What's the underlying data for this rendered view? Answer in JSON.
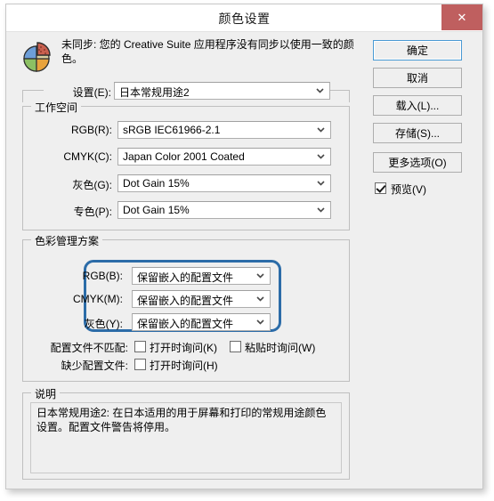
{
  "window": {
    "title": "颜色设置",
    "close_label": "✕"
  },
  "sync": {
    "icon": "color-wheel-icon",
    "message": "未同步: 您的 Creative Suite 应用程序没有同步以使用一致的颜色。"
  },
  "settings": {
    "label": "设置(E):",
    "value": "日本常规用途2"
  },
  "workspace": {
    "legend": "工作空间",
    "rows": [
      {
        "label": "RGB(R):",
        "value": "sRGB IEC61966-2.1"
      },
      {
        "label": "CMYK(C):",
        "value": "Japan Color 2001 Coated"
      },
      {
        "label": "灰色(G):",
        "value": "Dot Gain 15%"
      },
      {
        "label": "专色(P):",
        "value": "Dot Gain 15%"
      }
    ]
  },
  "color_management": {
    "legend": "色彩管理方案",
    "rows": [
      {
        "label": "RGB(B):",
        "value": "保留嵌入的配置文件"
      },
      {
        "label": "CMYK(M):",
        "value": "保留嵌入的配置文件"
      },
      {
        "label": "灰色(Y):",
        "value": "保留嵌入的配置文件"
      }
    ],
    "highlight_color": "#2c6ca8",
    "mismatch_label": "配置文件不匹配:",
    "mismatch_open": "打开时询问(K)",
    "mismatch_paste": "粘贴时询问(W)",
    "missing_label": "缺少配置文件:",
    "missing_open": "打开时询问(H)"
  },
  "description": {
    "legend": "说明",
    "text": "日本常规用途2: 在日本适用的用于屏幕和打印的常规用途颜色设置。配置文件警告将停用。"
  },
  "buttons": {
    "ok": "确定",
    "cancel": "取消",
    "load": "载入(L)...",
    "save": "存储(S)...",
    "more_options": "更多选项(O)",
    "preview": "预览(V)"
  }
}
